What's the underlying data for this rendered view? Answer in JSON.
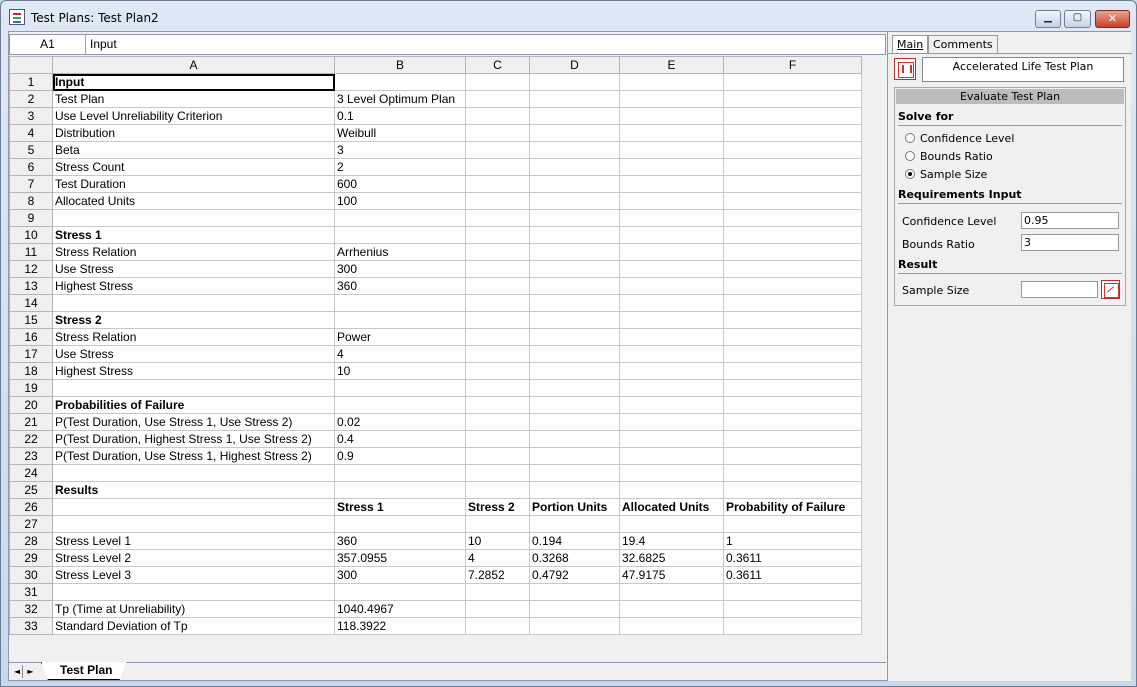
{
  "window": {
    "title": "Test Plans: Test Plan2",
    "min_glyph": "▁",
    "max_glyph": "▢",
    "close_glyph": "✕"
  },
  "formula_bar": {
    "cell_ref": "A1",
    "content": "Input"
  },
  "grid": {
    "columns": [
      "A",
      "B",
      "C",
      "D",
      "E",
      "F"
    ],
    "rows": [
      {
        "n": "1",
        "cells": [
          "Input",
          "",
          "",
          "",
          "",
          ""
        ],
        "bold": [
          0
        ]
      },
      {
        "n": "2",
        "cells": [
          "Test Plan",
          "3 Level Optimum Plan",
          "",
          "",
          "",
          ""
        ],
        "bold": []
      },
      {
        "n": "3",
        "cells": [
          "Use Level Unreliability Criterion",
          "0.1",
          "",
          "",
          "",
          ""
        ],
        "bold": []
      },
      {
        "n": "4",
        "cells": [
          "Distribution",
          "Weibull",
          "",
          "",
          "",
          ""
        ],
        "bold": []
      },
      {
        "n": "5",
        "cells": [
          "Beta",
          "3",
          "",
          "",
          "",
          ""
        ],
        "bold": []
      },
      {
        "n": "6",
        "cells": [
          "Stress Count",
          "2",
          "",
          "",
          "",
          ""
        ],
        "bold": []
      },
      {
        "n": "7",
        "cells": [
          "Test Duration",
          "600",
          "",
          "",
          "",
          ""
        ],
        "bold": []
      },
      {
        "n": "8",
        "cells": [
          "Allocated Units",
          "100",
          "",
          "",
          "",
          ""
        ],
        "bold": []
      },
      {
        "n": "9",
        "cells": [
          "",
          "",
          "",
          "",
          "",
          ""
        ],
        "bold": []
      },
      {
        "n": "10",
        "cells": [
          "Stress 1",
          "",
          "",
          "",
          "",
          ""
        ],
        "bold": [
          0
        ]
      },
      {
        "n": "11",
        "cells": [
          "Stress Relation",
          "Arrhenius",
          "",
          "",
          "",
          ""
        ],
        "bold": []
      },
      {
        "n": "12",
        "cells": [
          "Use Stress",
          "300",
          "",
          "",
          "",
          ""
        ],
        "bold": []
      },
      {
        "n": "13",
        "cells": [
          "Highest Stress",
          "360",
          "",
          "",
          "",
          ""
        ],
        "bold": []
      },
      {
        "n": "14",
        "cells": [
          "",
          "",
          "",
          "",
          "",
          ""
        ],
        "bold": []
      },
      {
        "n": "15",
        "cells": [
          "Stress 2",
          "",
          "",
          "",
          "",
          ""
        ],
        "bold": [
          0
        ]
      },
      {
        "n": "16",
        "cells": [
          "Stress Relation",
          "Power",
          "",
          "",
          "",
          ""
        ],
        "bold": []
      },
      {
        "n": "17",
        "cells": [
          "Use Stress",
          "4",
          "",
          "",
          "",
          ""
        ],
        "bold": []
      },
      {
        "n": "18",
        "cells": [
          "Highest Stress",
          "10",
          "",
          "",
          "",
          ""
        ],
        "bold": []
      },
      {
        "n": "19",
        "cells": [
          "",
          "",
          "",
          "",
          "",
          ""
        ],
        "bold": []
      },
      {
        "n": "20",
        "cells": [
          "Probabilities of Failure",
          "",
          "",
          "",
          "",
          ""
        ],
        "bold": [
          0
        ]
      },
      {
        "n": "21",
        "cells": [
          "P(Test Duration, Use Stress 1, Use Stress 2)",
          "0.02",
          "",
          "",
          "",
          ""
        ],
        "bold": []
      },
      {
        "n": "22",
        "cells": [
          "P(Test Duration, Highest Stress 1, Use Stress 2)",
          "0.4",
          "",
          "",
          "",
          ""
        ],
        "bold": []
      },
      {
        "n": "23",
        "cells": [
          "P(Test Duration, Use Stress 1, Highest Stress 2)",
          "0.9",
          "",
          "",
          "",
          ""
        ],
        "bold": []
      },
      {
        "n": "24",
        "cells": [
          "",
          "",
          "",
          "",
          "",
          ""
        ],
        "bold": []
      },
      {
        "n": "25",
        "cells": [
          "Results",
          "",
          "",
          "",
          "",
          ""
        ],
        "bold": [
          0
        ]
      },
      {
        "n": "26",
        "cells": [
          "",
          "Stress 1",
          "Stress 2",
          "Portion Units",
          "Allocated Units",
          "Probability of Failure"
        ],
        "bold": [
          1,
          2,
          3,
          4,
          5
        ]
      },
      {
        "n": "27",
        "cells": [
          "",
          "",
          "",
          "",
          "",
          ""
        ],
        "bold": []
      },
      {
        "n": "28",
        "cells": [
          "Stress Level 1",
          "360",
          "10",
          "0.194",
          "19.4",
          "1"
        ],
        "bold": []
      },
      {
        "n": "29",
        "cells": [
          "Stress Level 2",
          "357.0955",
          "4",
          "0.3268",
          "32.6825",
          "0.3611"
        ],
        "bold": []
      },
      {
        "n": "30",
        "cells": [
          "Stress Level 3",
          "300",
          "7.2852",
          "0.4792",
          "47.9175",
          "0.3611"
        ],
        "bold": []
      },
      {
        "n": "31",
        "cells": [
          "",
          "",
          "",
          "",
          "",
          ""
        ],
        "bold": []
      },
      {
        "n": "32",
        "cells": [
          "Tp (Time at Unreliability)",
          "1040.4967",
          "",
          "",
          "",
          ""
        ],
        "bold": []
      },
      {
        "n": "33",
        "cells": [
          "Standard Deviation of Tp",
          "118.3922",
          "",
          "",
          "",
          ""
        ],
        "bold": []
      }
    ]
  },
  "sheet_tabs": {
    "nav_left": "◄",
    "nav_right": "►",
    "active": "Test Plan"
  },
  "panel": {
    "tabs": {
      "main": "Main",
      "comments": "Comments"
    },
    "plan_name": "Accelerated Life Test Plan",
    "eval_header": "Evaluate Test Plan",
    "solve_for_label": "Solve for",
    "options": [
      {
        "label": "Confidence Level",
        "selected": false
      },
      {
        "label": "Bounds Ratio",
        "selected": false
      },
      {
        "label": "Sample Size",
        "selected": true
      }
    ],
    "requirements_label": "Requirements Input",
    "confidence_label": "Confidence Level",
    "confidence_value": "0.95",
    "bounds_label": "Bounds Ratio",
    "bounds_value": "3",
    "result_label": "Result",
    "sample_size_label": "Sample Size",
    "sample_size_value": ""
  }
}
